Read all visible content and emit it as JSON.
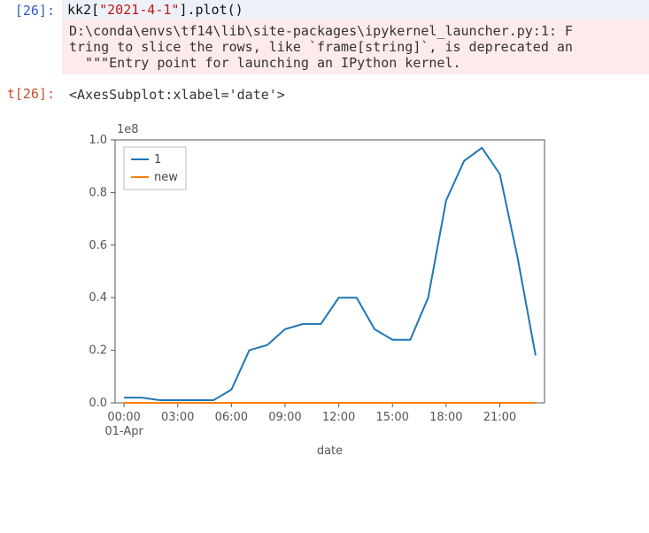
{
  "input_cell": {
    "prompt": "[26]:",
    "code_ident": "kk2",
    "code_bracket_open": "[",
    "code_string": "\"2021-4-1\"",
    "code_bracket_close": "]",
    "code_tail": ".plot()"
  },
  "warning": {
    "line1": "D:\\conda\\envs\\tf14\\lib\\site-packages\\ipykernel_launcher.py:1: F",
    "line2": "tring to slice the rows, like `frame[string]`, is deprecated an",
    "line3": "  \"\"\"Entry point for launching an IPython kernel."
  },
  "output_cell": {
    "prompt": "t[26]:",
    "repr": "<AxesSubplot:xlabel='date'>"
  },
  "chart_data": {
    "type": "line",
    "title": "",
    "xlabel": "date",
    "ylabel": "",
    "y_scale_text": "1e8",
    "ylim": [
      0.0,
      1.0
    ],
    "y_ticks": [
      0.0,
      0.2,
      0.4,
      0.6,
      0.8,
      1.0
    ],
    "x_tick_labels": [
      "00:00",
      "03:00",
      "06:00",
      "09:00",
      "12:00",
      "15:00",
      "18:00",
      "21:00"
    ],
    "x_secondary_label": "01-Apr",
    "x_hours": [
      0,
      1,
      2,
      3,
      4,
      5,
      6,
      7,
      8,
      9,
      10,
      11,
      12,
      13,
      14,
      15,
      16,
      17,
      18,
      19,
      20,
      21,
      22,
      23
    ],
    "series": [
      {
        "name": "1",
        "color": "#1f77b4",
        "values": [
          0.02,
          0.02,
          0.01,
          0.01,
          0.01,
          0.01,
          0.05,
          0.2,
          0.22,
          0.28,
          0.3,
          0.3,
          0.4,
          0.4,
          0.28,
          0.24,
          0.24,
          0.4,
          0.77,
          0.92,
          0.97,
          0.87,
          0.55,
          0.18
        ]
      },
      {
        "name": "new",
        "color": "#ff7f0e",
        "values": [
          0.0,
          0.0,
          0.0,
          0.0,
          0.0,
          0.0,
          0.0,
          0.0,
          0.0,
          0.0,
          0.0,
          0.0,
          0.0,
          0.0,
          0.0,
          0.0,
          0.0,
          0.0,
          0.0,
          0.0,
          0.0,
          0.0,
          0.0,
          0.0
        ]
      }
    ],
    "legend": {
      "items": [
        "1",
        "new"
      ]
    }
  }
}
